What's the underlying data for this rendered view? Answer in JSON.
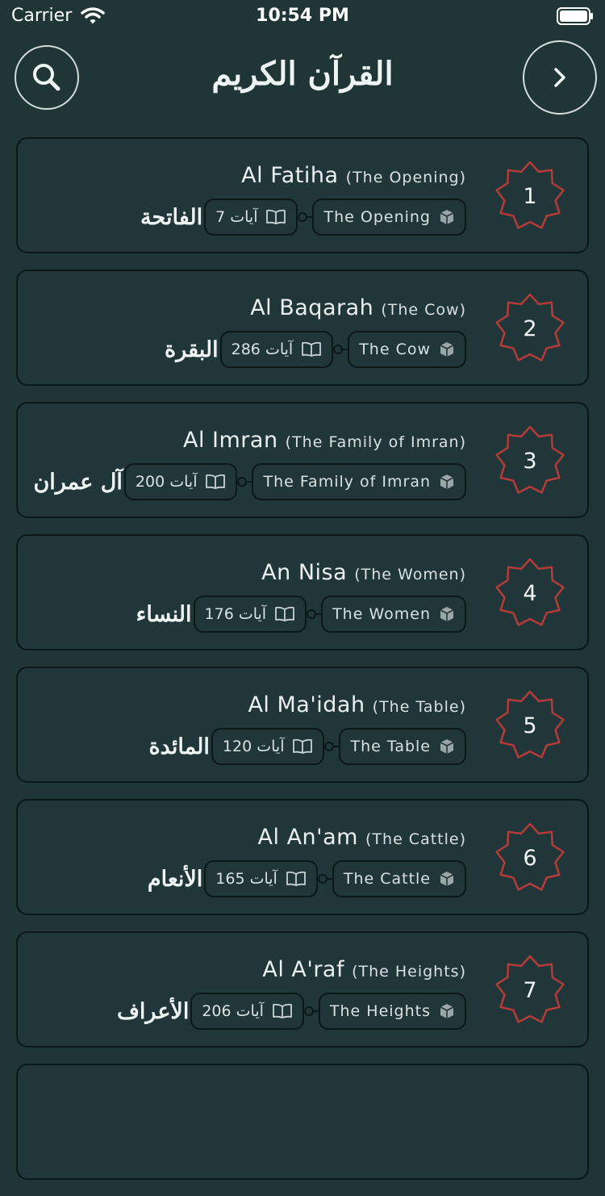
{
  "status": {
    "carrier": "Carrier",
    "time": "10:54 PM"
  },
  "header": {
    "title": "القرآن الكريم"
  },
  "theme": {
    "background": "#1f3536",
    "card": "#213638",
    "badge_red": "#b53a3a",
    "border": "#0c1718"
  },
  "surahs": [
    {
      "number": "1",
      "name": "Al Fatiha",
      "meaning": "(The Opening)",
      "arabic": "الفاتحة",
      "verses": "7 آيات",
      "revelation_label": "The Opening"
    },
    {
      "number": "2",
      "name": "Al Baqarah",
      "meaning": "(The Cow)",
      "arabic": "البقرة",
      "verses": "286 آيات",
      "revelation_label": "The Cow"
    },
    {
      "number": "3",
      "name": "Al Imran",
      "meaning": "(The Family of Imran)",
      "arabic": "آل عمران",
      "verses": "200 آيات",
      "revelation_label": "The Family of Imran"
    },
    {
      "number": "4",
      "name": "An Nisa",
      "meaning": "(The Women)",
      "arabic": "النساء",
      "verses": "176 آيات",
      "revelation_label": "The Women"
    },
    {
      "number": "5",
      "name": "Al Ma'idah",
      "meaning": "(The Table)",
      "arabic": "المائدة",
      "verses": "120 آيات",
      "revelation_label": "The Table"
    },
    {
      "number": "6",
      "name": "Al An'am",
      "meaning": "(The Cattle)",
      "arabic": "الأنعام",
      "verses": "165 آيات",
      "revelation_label": "The Cattle"
    },
    {
      "number": "7",
      "name": "Al A'raf",
      "meaning": "(The Heights)",
      "arabic": "الأعراف",
      "verses": "206 آيات",
      "revelation_label": "The Heights"
    }
  ]
}
